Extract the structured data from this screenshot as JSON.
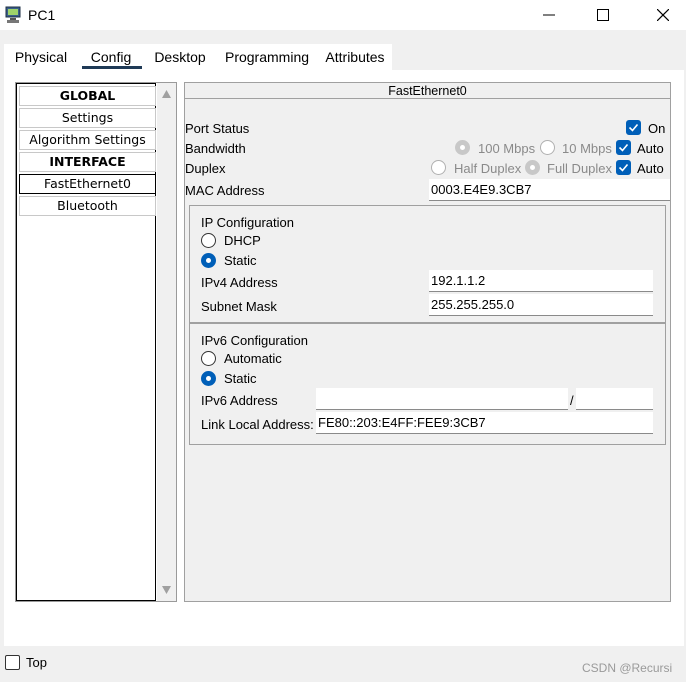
{
  "window": {
    "title": "PC1",
    "controls": {
      "minimize": "minimize",
      "maximize": "maximize",
      "close": "close"
    }
  },
  "tabs": [
    {
      "label": "Physical",
      "active": false
    },
    {
      "label": "Config",
      "active": true
    },
    {
      "label": "Desktop",
      "active": false
    },
    {
      "label": "Programming",
      "active": false
    },
    {
      "label": "Attributes",
      "active": false
    }
  ],
  "sidebar": {
    "items": [
      {
        "label": "GLOBAL",
        "type": "header"
      },
      {
        "label": "Settings",
        "type": "item"
      },
      {
        "label": "Algorithm Settings",
        "type": "item"
      },
      {
        "label": "INTERFACE",
        "type": "header"
      },
      {
        "label": "FastEthernet0",
        "type": "item",
        "selected": true
      },
      {
        "label": "Bluetooth",
        "type": "item"
      }
    ]
  },
  "panel": {
    "title": "FastEthernet0",
    "port_status": {
      "label": "Port Status",
      "on_label": "On",
      "on_checked": true
    },
    "bandwidth": {
      "label": "Bandwidth",
      "option_100": "100 Mbps",
      "option_10": "10 Mbps",
      "auto_label": "Auto",
      "auto_checked": true,
      "selected": "100 Mbps"
    },
    "duplex": {
      "label": "Duplex",
      "option_half": "Half Duplex",
      "option_full": "Full Duplex",
      "auto_label": "Auto",
      "auto_checked": true,
      "selected": "Full Duplex"
    },
    "mac": {
      "label": "MAC Address",
      "value": "0003.E4E9.3CB7"
    },
    "ipv4": {
      "title": "IP Configuration",
      "dhcp_label": "DHCP",
      "static_label": "Static",
      "selected": "Static",
      "address_label": "IPv4 Address",
      "address_value": "192.1.1.2",
      "mask_label": "Subnet Mask",
      "mask_value": "255.255.255.0"
    },
    "ipv6": {
      "title": "IPv6 Configuration",
      "auto_label": "Automatic",
      "static_label": "Static",
      "selected": "Static",
      "address_label": "IPv6 Address",
      "address_value": "",
      "separator": "/",
      "prefix_value": "",
      "link_local_label": "Link Local Address:",
      "link_local_value": "FE80::203:E4FF:FEE9:3CB7"
    }
  },
  "footer": {
    "top_label": "Top",
    "top_checked": false,
    "watermark": "CSDN @Recursi"
  },
  "colors": {
    "accent": "#005fb8",
    "tab_underline": "#1f3a56",
    "background": "#f0f0f0"
  }
}
